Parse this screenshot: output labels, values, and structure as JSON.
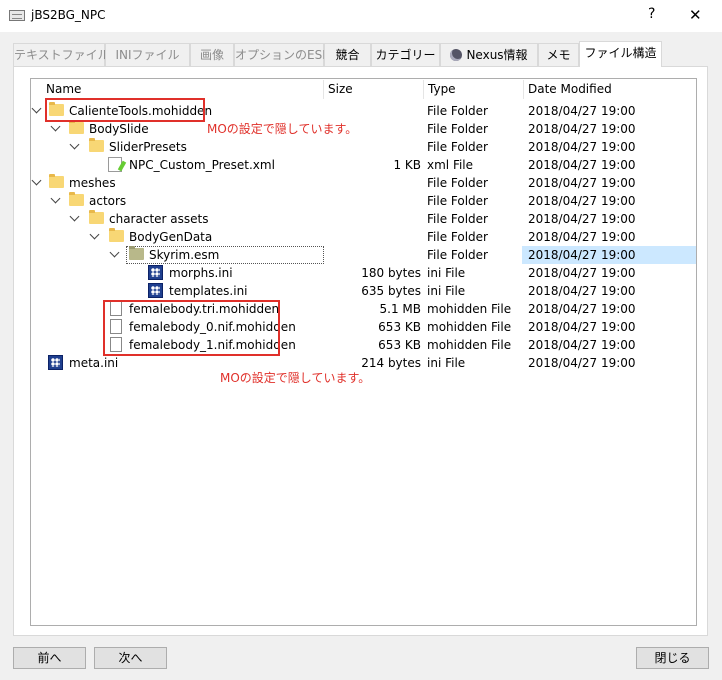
{
  "window": {
    "title": "jBS2BG_NPC",
    "help_label": "?",
    "close_label": "✕"
  },
  "tabs": [
    {
      "label": "テキストファイル",
      "enabled": false
    },
    {
      "label": "INIファイル",
      "enabled": false
    },
    {
      "label": "画像",
      "enabled": false
    },
    {
      "label": "オプションのESP",
      "enabled": false
    },
    {
      "label": "競合",
      "enabled": true
    },
    {
      "label": "カテゴリー",
      "enabled": true
    },
    {
      "label": "Nexus情報",
      "enabled": true,
      "icon": "globe-icon"
    },
    {
      "label": "メモ",
      "enabled": true
    },
    {
      "label": "ファイル構造",
      "enabled": true,
      "active": true
    }
  ],
  "columns": {
    "name": "Name",
    "size": "Size",
    "type": "Type",
    "date": "Date Modified"
  },
  "rows": [
    {
      "name": "CalienteTools.mohidden",
      "size": "",
      "type": "File Folder",
      "date": "2018/04/27 19:00",
      "icon": "folder-icon",
      "expanded": true
    },
    {
      "name": "BodySlide",
      "size": "",
      "type": "File Folder",
      "date": "2018/04/27 19:00",
      "icon": "folder-icon",
      "expanded": true
    },
    {
      "name": "SliderPresets",
      "size": "",
      "type": "File Folder",
      "date": "2018/04/27 19:00",
      "icon": "folder-icon",
      "expanded": true
    },
    {
      "name": "NPC_Custom_Preset.xml",
      "size": "1 KB",
      "type": "xml File",
      "date": "2018/04/27 19:00",
      "icon": "xml-file-icon"
    },
    {
      "name": "meshes",
      "size": "",
      "type": "File Folder",
      "date": "2018/04/27 19:00",
      "icon": "folder-icon",
      "expanded": true
    },
    {
      "name": "actors",
      "size": "",
      "type": "File Folder",
      "date": "2018/04/27 19:00",
      "icon": "folder-icon",
      "expanded": true
    },
    {
      "name": "character assets",
      "size": "",
      "type": "File Folder",
      "date": "2018/04/27 19:00",
      "icon": "folder-icon",
      "expanded": true
    },
    {
      "name": "BodyGenData",
      "size": "",
      "type": "File Folder",
      "date": "2018/04/27 19:00",
      "icon": "folder-icon",
      "expanded": true
    },
    {
      "name": "Skyrim.esm",
      "size": "",
      "type": "File Folder",
      "date": "2018/04/27 19:00",
      "icon": "folder-icon",
      "expanded": true,
      "selected": true
    },
    {
      "name": "morphs.ini",
      "size": "180 bytes",
      "type": "ini File",
      "date": "2018/04/27 19:00",
      "icon": "ini-file-icon"
    },
    {
      "name": "templates.ini",
      "size": "635 bytes",
      "type": "ini File",
      "date": "2018/04/27 19:00",
      "icon": "ini-file-icon"
    },
    {
      "name": "femalebody.tri.mohidden",
      "size": "5.1 MB",
      "type": "mohidden File",
      "date": "2018/04/27 19:00",
      "icon": "file-icon"
    },
    {
      "name": "femalebody_0.nif.mohidden",
      "size": "653 KB",
      "type": "mohidden File",
      "date": "2018/04/27 19:00",
      "icon": "file-icon"
    },
    {
      "name": "femalebody_1.nif.mohidden",
      "size": "653 KB",
      "type": "mohidden File",
      "date": "2018/04/27 19:00",
      "icon": "file-icon"
    },
    {
      "name": "meta.ini",
      "size": "214 bytes",
      "type": "ini File",
      "date": "2018/04/27 19:00",
      "icon": "ini-file-icon"
    }
  ],
  "annotations": {
    "note_1": "MOの設定で隠しています。",
    "note_2": "MOの設定で隠しています。",
    "color": "#e0302a"
  },
  "buttons": {
    "prev": "前へ",
    "next": "次へ",
    "close": "閉じる"
  }
}
